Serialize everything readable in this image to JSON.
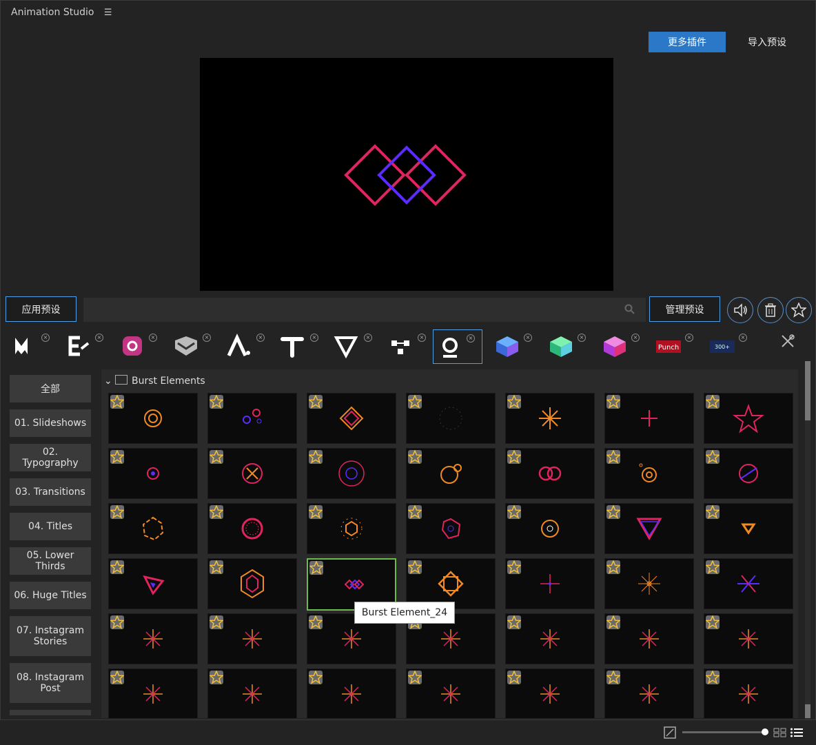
{
  "app": {
    "title": "Animation Studio",
    "menu_icon": "hamburger-icon"
  },
  "header": {
    "more_plugins": "更多插件",
    "import_preset": "导入预设"
  },
  "toolbar": {
    "apply_preset": "应用预设",
    "manage_preset": "管理预设",
    "search_placeholder": ""
  },
  "sidebar": {
    "items": [
      "全部",
      "01. Slideshows",
      "02. Typography",
      "03. Transitions",
      "04. Titles",
      "05. Lower Thirds",
      "06. Huge Titles",
      "07. Instagram\nStories",
      "08. Instagram\nPost"
    ]
  },
  "folder": {
    "name": "Burst Elements"
  },
  "tooltip": {
    "text": "Burst Element_24"
  },
  "colors": {
    "accent": "#2b77c8",
    "selection": "#6dbb4b",
    "red": "#e0245e",
    "blue": "#5a2cff",
    "orange": "#f08a24"
  }
}
